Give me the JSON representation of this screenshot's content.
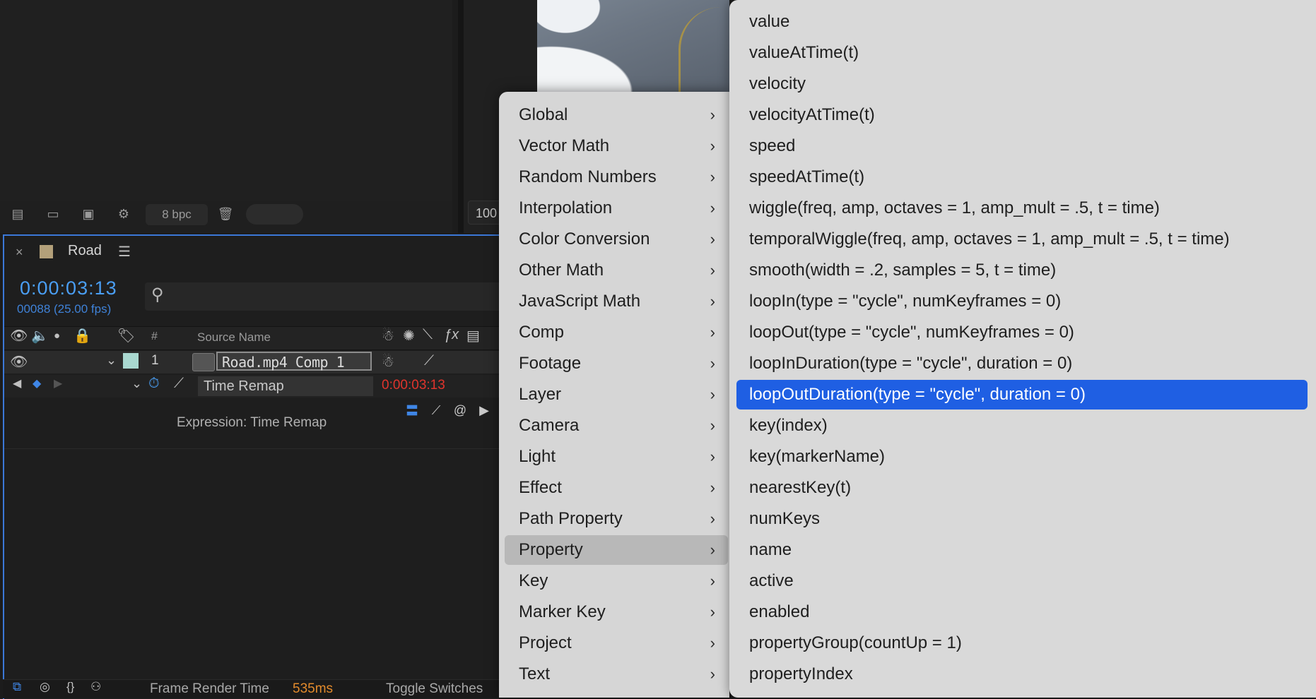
{
  "project_panel": {
    "bpc_label": "8 bpc",
    "zoom_value": "100"
  },
  "timeline": {
    "tab_close": "×",
    "tab_title": "Road",
    "tab_menu": "☰",
    "timecode": "0:00:03:13",
    "frame_info": "00088 (25.00 fps)",
    "columns": {
      "number": "#",
      "source_name": "Source Name"
    },
    "layer": {
      "number": "1",
      "name": "Road.mp4 Comp 1"
    },
    "property": {
      "name": "Time Remap",
      "value": "0:00:03:13"
    },
    "expression_label": "Expression: Time Remap",
    "status": {
      "render_label": "Frame Render Time",
      "render_value": "535ms",
      "toggle_label": "Toggle Switches"
    }
  },
  "main_menu": {
    "items": [
      {
        "label": "Global"
      },
      {
        "label": "Vector Math"
      },
      {
        "label": "Random Numbers"
      },
      {
        "label": "Interpolation"
      },
      {
        "label": "Color Conversion"
      },
      {
        "label": "Other Math"
      },
      {
        "label": "JavaScript Math"
      },
      {
        "label": "Comp"
      },
      {
        "label": "Footage"
      },
      {
        "label": "Layer"
      },
      {
        "label": "Camera"
      },
      {
        "label": "Light"
      },
      {
        "label": "Effect"
      },
      {
        "label": "Path Property"
      },
      {
        "label": "Property"
      },
      {
        "label": "Key"
      },
      {
        "label": "Marker Key"
      },
      {
        "label": "Project"
      },
      {
        "label": "Text"
      }
    ],
    "highlighted": "Property"
  },
  "sub_menu": {
    "items": [
      {
        "label": "value"
      },
      {
        "label": "valueAtTime(t)"
      },
      {
        "label": "velocity"
      },
      {
        "label": "velocityAtTime(t)"
      },
      {
        "label": "speed"
      },
      {
        "label": "speedAtTime(t)"
      },
      {
        "label": "wiggle(freq, amp, octaves = 1, amp_mult = .5, t = time)"
      },
      {
        "label": "temporalWiggle(freq, amp, octaves = 1, amp_mult = .5, t = time)"
      },
      {
        "label": "smooth(width = .2, samples = 5, t = time)"
      },
      {
        "label": "loopIn(type = \"cycle\", numKeyframes = 0)"
      },
      {
        "label": "loopOut(type = \"cycle\", numKeyframes = 0)"
      },
      {
        "label": "loopInDuration(type = \"cycle\", duration = 0)"
      },
      {
        "label": "loopOutDuration(type = \"cycle\", duration = 0)"
      },
      {
        "label": "key(index)"
      },
      {
        "label": "key(markerName)"
      },
      {
        "label": "nearestKey(t)"
      },
      {
        "label": "numKeys"
      },
      {
        "label": "name"
      },
      {
        "label": "active"
      },
      {
        "label": "enabled"
      },
      {
        "label": "propertyGroup(countUp = 1)"
      },
      {
        "label": "propertyIndex"
      }
    ],
    "selected": "loopOutDuration(type = \"cycle\", duration = 0)"
  },
  "colors": {
    "accent": "#1f5fe3",
    "timecode": "#4a9ef3",
    "property_value": "#e0342c",
    "render_value": "#e28a2c"
  }
}
